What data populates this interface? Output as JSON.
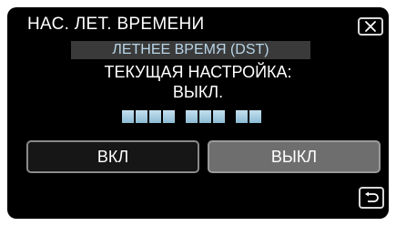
{
  "header": {
    "title": "НАС. ЛЕТ. ВРЕМЕНИ",
    "close_icon": "close-icon"
  },
  "subtitle": "ЛЕТНЕЕ ВРЕМЯ (DST)",
  "current_setting": {
    "label": "ТЕКУЩАЯ НАСТРОЙКА:",
    "value": "ВЫКЛ."
  },
  "options": {
    "on_label": "ВКЛ",
    "off_label": "ВЫКЛ"
  },
  "footer": {
    "back_icon": "return-icon"
  },
  "colors": {
    "background": "#000000",
    "accent_text": "#b8d5e8",
    "selected_button": "#6e6e6e"
  }
}
